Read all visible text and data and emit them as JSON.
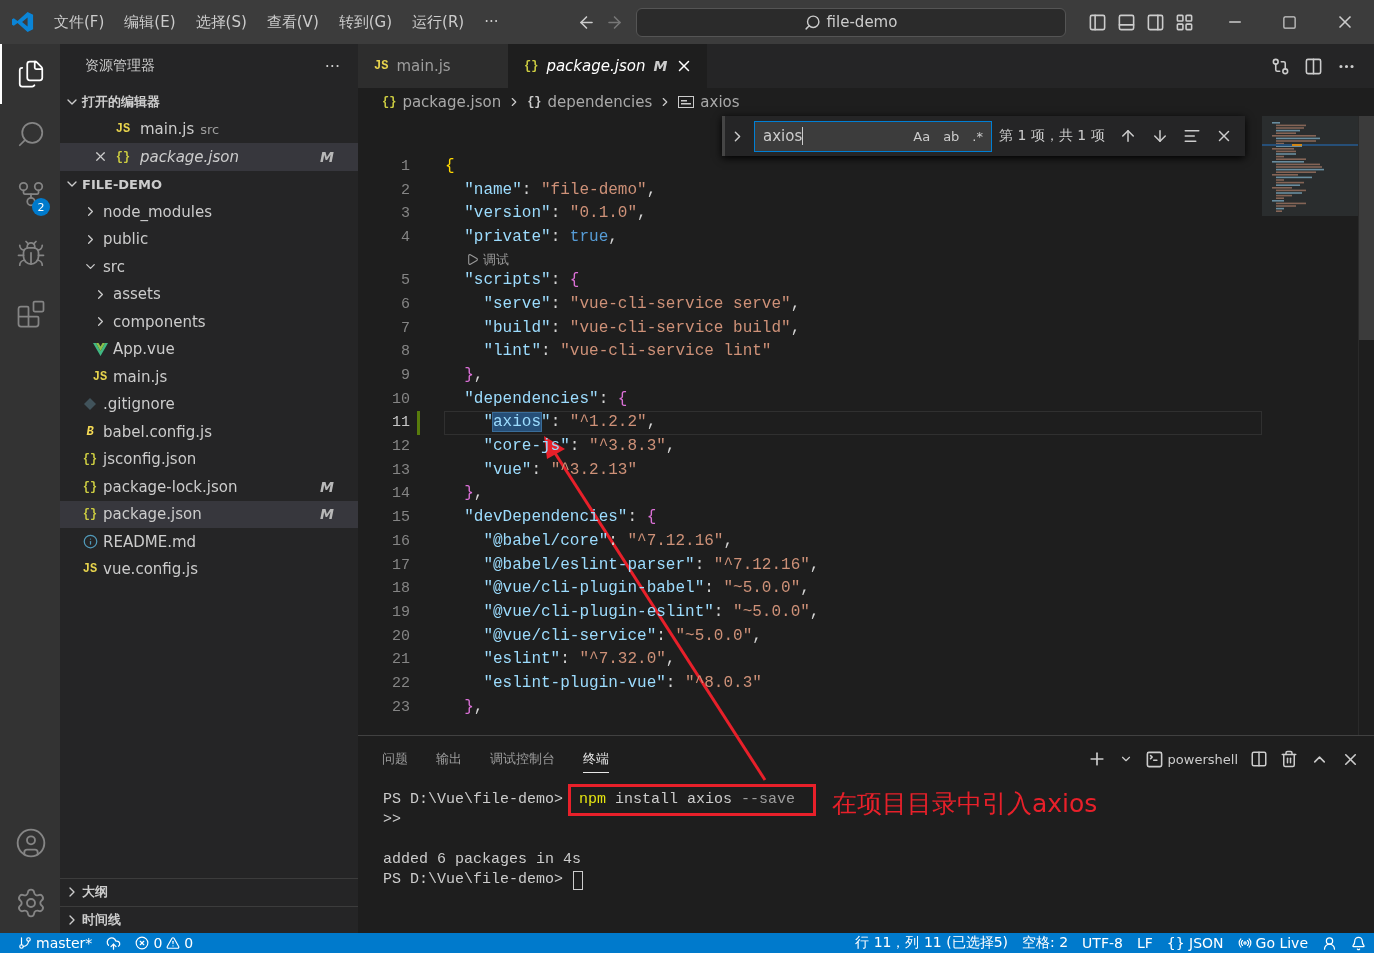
{
  "title_bar": {
    "menus": [
      "文件(F)",
      "编辑(E)",
      "选择(S)",
      "查看(V)",
      "转到(G)",
      "运行(R)"
    ],
    "more": "···",
    "search": "file-demo"
  },
  "activity_bar": {
    "items": [
      {
        "kind": "explorer",
        "selected": true
      },
      {
        "kind": "search",
        "selected": false
      },
      {
        "kind": "scm",
        "selected": false,
        "badge": "2"
      },
      {
        "kind": "debug",
        "selected": false
      },
      {
        "kind": "extensions",
        "selected": false
      }
    ],
    "bottom": [
      {
        "kind": "account"
      },
      {
        "kind": "settings"
      }
    ]
  },
  "sidebar": {
    "title": "资源管理器",
    "more": "···",
    "open_editors": {
      "title": "打开的编辑器",
      "expanded": true,
      "items": [
        {
          "icon": "JS",
          "kind": "js",
          "name": "main.js",
          "detail": "src",
          "selected": false,
          "italic": false,
          "closable": false
        },
        {
          "icon": "{}",
          "kind": "json",
          "name": "package.json",
          "status": "M",
          "selected": true,
          "italic": true,
          "closable": true
        }
      ]
    },
    "folder": {
      "title": "FILE-DEMO",
      "expanded": true,
      "items": [
        {
          "kind": "folder",
          "name": "node_modules",
          "expanded": false,
          "selected": false
        },
        {
          "kind": "folder",
          "name": "public",
          "expanded": false,
          "selected": false
        },
        {
          "kind": "folder",
          "name": "src",
          "expanded": true,
          "selected": false,
          "children": [
            {
              "kind": "folder",
              "name": "assets",
              "expanded": false,
              "selected": false
            },
            {
              "kind": "folder",
              "name": "components",
              "expanded": false,
              "selected": false
            },
            {
              "kind": "vue",
              "name": "App.vue",
              "selected": false
            },
            {
              "kind": "js",
              "icon": "JS",
              "name": "main.js",
              "selected": false
            }
          ]
        },
        {
          "kind": "git",
          "name": ".gitignore",
          "selected": false
        },
        {
          "kind": "babel",
          "icon": "B",
          "name": "babel.config.js",
          "selected": false
        },
        {
          "kind": "json",
          "icon": "{}",
          "name": "jsconfig.json",
          "selected": false
        },
        {
          "kind": "json",
          "icon": "{}",
          "name": "package-lock.json",
          "status": "M",
          "selected": false
        },
        {
          "kind": "json",
          "icon": "{}",
          "name": "package.json",
          "status": "M",
          "selected": true
        },
        {
          "kind": "info",
          "name": "README.md",
          "selected": false
        },
        {
          "kind": "js",
          "icon": "JS",
          "name": "vue.config.js",
          "selected": false
        }
      ]
    },
    "bottom_sections": [
      {
        "title": "大纲",
        "expanded": false
      },
      {
        "title": "时间线",
        "expanded": false
      }
    ]
  },
  "editor": {
    "tabs": [
      {
        "icon": "JS",
        "kind": "js",
        "label": "main.js",
        "selected": false,
        "italic": false,
        "closable": false
      },
      {
        "icon": "{}",
        "kind": "json",
        "label": "package.json",
        "status": "M",
        "selected": true,
        "italic": true,
        "closable": true
      }
    ],
    "breadcrumbs": [
      {
        "kind": "object",
        "icon": "{}",
        "label": "package.json"
      },
      {
        "kind": "object",
        "icon": "{}",
        "label": "dependencies"
      },
      {
        "kind": "string",
        "label": "axios"
      }
    ],
    "find": {
      "value": "axios",
      "options": [
        {
          "label": "Aa",
          "selected": false
        },
        {
          "label": "ab",
          "selected": false
        },
        {
          "label": ".*",
          "selected": false
        }
      ],
      "result": "第 1 项，共 1 项"
    },
    "lines": [
      {
        "kind": "code",
        "number": "1",
        "current": false,
        "changed": false,
        "tokens": [
          {
            "kind": "b1",
            "text": "{"
          }
        ]
      },
      {
        "kind": "code",
        "number": "2",
        "current": false,
        "changed": false,
        "tokens": [
          {
            "kind": "key",
            "text": "  \"name\""
          },
          {
            "kind": "p",
            "text": ": "
          },
          {
            "kind": "str",
            "text": "\"file-demo\""
          },
          {
            "kind": "p",
            "text": ","
          }
        ]
      },
      {
        "kind": "code",
        "number": "3",
        "current": false,
        "changed": false,
        "tokens": [
          {
            "kind": "key",
            "text": "  \"version\""
          },
          {
            "kind": "p",
            "text": ": "
          },
          {
            "kind": "str",
            "text": "\"0.1.0\""
          },
          {
            "kind": "p",
            "text": ","
          }
        ]
      },
      {
        "kind": "code",
        "number": "4",
        "current": false,
        "changed": false,
        "tokens": [
          {
            "kind": "key",
            "text": "  \"private\""
          },
          {
            "kind": "p",
            "text": ": "
          },
          {
            "kind": "lit",
            "text": "true"
          },
          {
            "kind": "p",
            "text": ","
          }
        ]
      },
      {
        "kind": "codelens",
        "label": "调试"
      },
      {
        "kind": "code",
        "number": "5",
        "current": false,
        "changed": false,
        "tokens": [
          {
            "kind": "key",
            "text": "  \"scripts\""
          },
          {
            "kind": "p",
            "text": ": "
          },
          {
            "kind": "b2",
            "text": "{"
          }
        ]
      },
      {
        "kind": "code",
        "number": "6",
        "current": false,
        "changed": false,
        "tokens": [
          {
            "kind": "key",
            "text": "    \"serve\""
          },
          {
            "kind": "p",
            "text": ": "
          },
          {
            "kind": "str",
            "text": "\"vue-cli-service serve\""
          },
          {
            "kind": "p",
            "text": ","
          }
        ]
      },
      {
        "kind": "code",
        "number": "7",
        "current": false,
        "changed": false,
        "tokens": [
          {
            "kind": "key",
            "text": "    \"build\""
          },
          {
            "kind": "p",
            "text": ": "
          },
          {
            "kind": "str",
            "text": "\"vue-cli-service build\""
          },
          {
            "kind": "p",
            "text": ","
          }
        ]
      },
      {
        "kind": "code",
        "number": "8",
        "current": false,
        "changed": false,
        "tokens": [
          {
            "kind": "key",
            "text": "    \"lint\""
          },
          {
            "kind": "p",
            "text": ": "
          },
          {
            "kind": "str",
            "text": "\"vue-cli-service lint\""
          }
        ]
      },
      {
        "kind": "code",
        "number": "9",
        "current": false,
        "changed": false,
        "tokens": [
          {
            "kind": "b2",
            "text": "  }"
          },
          {
            "kind": "p",
            "text": ","
          }
        ]
      },
      {
        "kind": "code",
        "number": "10",
        "current": false,
        "changed": false,
        "tokens": [
          {
            "kind": "key",
            "text": "  \"dependencies\""
          },
          {
            "kind": "p",
            "text": ": "
          },
          {
            "kind": "b2",
            "text": "{"
          }
        ]
      },
      {
        "kind": "code",
        "number": "11",
        "current": true,
        "changed": true,
        "tokens": [
          {
            "kind": "key",
            "text": "    \""
          },
          {
            "kind": "match",
            "text": "axios"
          },
          {
            "kind": "key",
            "text": "\""
          },
          {
            "kind": "p",
            "text": ": "
          },
          {
            "kind": "str",
            "text": "\"^1.2.2\""
          },
          {
            "kind": "p",
            "text": ","
          }
        ]
      },
      {
        "kind": "code",
        "number": "12",
        "current": false,
        "changed": false,
        "tokens": [
          {
            "kind": "key",
            "text": "    \"core-js\""
          },
          {
            "kind": "p",
            "text": ": "
          },
          {
            "kind": "str",
            "text": "\"^3.8.3\""
          },
          {
            "kind": "p",
            "text": ","
          }
        ]
      },
      {
        "kind": "code",
        "number": "13",
        "current": false,
        "changed": false,
        "tokens": [
          {
            "kind": "key",
            "text": "    \"vue\""
          },
          {
            "kind": "p",
            "text": ": "
          },
          {
            "kind": "str",
            "text": "\"^3.2.13\""
          }
        ]
      },
      {
        "kind": "code",
        "number": "14",
        "current": false,
        "changed": false,
        "tokens": [
          {
            "kind": "b2",
            "text": "  }"
          },
          {
            "kind": "p",
            "text": ","
          }
        ]
      },
      {
        "kind": "code",
        "number": "15",
        "current": false,
        "changed": false,
        "tokens": [
          {
            "kind": "key",
            "text": "  \"devDependencies\""
          },
          {
            "kind": "p",
            "text": ": "
          },
          {
            "kind": "b2",
            "text": "{"
          }
        ]
      },
      {
        "kind": "code",
        "number": "16",
        "current": false,
        "changed": false,
        "tokens": [
          {
            "kind": "key",
            "text": "    \"@babel/core\""
          },
          {
            "kind": "p",
            "text": ": "
          },
          {
            "kind": "str",
            "text": "\"^7.12.16\""
          },
          {
            "kind": "p",
            "text": ","
          }
        ]
      },
      {
        "kind": "code",
        "number": "17",
        "current": false,
        "changed": false,
        "tokens": [
          {
            "kind": "key",
            "text": "    \"@babel/eslint-parser\""
          },
          {
            "kind": "p",
            "text": ": "
          },
          {
            "kind": "str",
            "text": "\"^7.12.16\""
          },
          {
            "kind": "p",
            "text": ","
          }
        ]
      },
      {
        "kind": "code",
        "number": "18",
        "current": false,
        "changed": false,
        "tokens": [
          {
            "kind": "key",
            "text": "    \"@vue/cli-plugin-babel\""
          },
          {
            "kind": "p",
            "text": ": "
          },
          {
            "kind": "str",
            "text": "\"~5.0.0\""
          },
          {
            "kind": "p",
            "text": ","
          }
        ]
      },
      {
        "kind": "code",
        "number": "19",
        "current": false,
        "changed": false,
        "tokens": [
          {
            "kind": "key",
            "text": "    \"@vue/cli-plugin-eslint\""
          },
          {
            "kind": "p",
            "text": ": "
          },
          {
            "kind": "str",
            "text": "\"~5.0.0\""
          },
          {
            "kind": "p",
            "text": ","
          }
        ]
      },
      {
        "kind": "code",
        "number": "20",
        "current": false,
        "changed": false,
        "tokens": [
          {
            "kind": "key",
            "text": "    \"@vue/cli-service\""
          },
          {
            "kind": "p",
            "text": ": "
          },
          {
            "kind": "str",
            "text": "\"~5.0.0\""
          },
          {
            "kind": "p",
            "text": ","
          }
        ]
      },
      {
        "kind": "code",
        "number": "21",
        "current": false,
        "changed": false,
        "tokens": [
          {
            "kind": "key",
            "text": "    \"eslint\""
          },
          {
            "kind": "p",
            "text": ": "
          },
          {
            "kind": "str",
            "text": "\"^7.32.0\""
          },
          {
            "kind": "p",
            "text": ","
          }
        ]
      },
      {
        "kind": "code",
        "number": "22",
        "current": false,
        "changed": false,
        "tokens": [
          {
            "kind": "key",
            "text": "    \"eslint-plugin-vue\""
          },
          {
            "kind": "p",
            "text": ": "
          },
          {
            "kind": "str",
            "text": "\"^8.0.3\""
          }
        ]
      },
      {
        "kind": "code",
        "number": "23",
        "current": false,
        "changed": false,
        "tokens": [
          {
            "kind": "b2",
            "text": "  }"
          },
          {
            "kind": "p",
            "text": ","
          }
        ]
      }
    ]
  },
  "panel": {
    "tabs": [
      {
        "label": "问题",
        "selected": false
      },
      {
        "label": "输出",
        "selected": false
      },
      {
        "label": "调试控制台",
        "selected": false
      },
      {
        "label": "终端",
        "selected": true
      }
    ],
    "profile": "powershell",
    "blocks": [
      [
        {
          "segments": [
            {
              "kind": "prompt",
              "text": "PS D:\\Vue\\file-demo> "
            },
            {
              "kind": "cmd",
              "text": "npm"
            },
            {
              "kind": "arg",
              "text": " install axios "
            },
            {
              "kind": "flag",
              "text": "--save"
            }
          ],
          "cursor": false,
          "annotated": true
        },
        {
          "segments": [
            {
              "kind": "prompt",
              "text": ">>"
            }
          ],
          "cursor": false,
          "annotated": false
        }
      ],
      [
        {
          "segments": [
            {
              "kind": "arg",
              "text": "added 6 packages in 4s"
            }
          ],
          "cursor": false,
          "annotated": false
        },
        {
          "segments": [
            {
              "kind": "prompt",
              "text": "PS D:\\Vue\\file-demo> "
            }
          ],
          "cursor": true,
          "annotated": false
        }
      ]
    ]
  },
  "annotation": {
    "note": "在项目目录中引入axios"
  },
  "status_bar": {
    "branch": "master*",
    "errors": "0",
    "warnings": "0",
    "right": [
      {
        "kind": "text",
        "label": "行 11，列 11 (已选择5)"
      },
      {
        "kind": "text",
        "label": "空格: 2"
      },
      {
        "kind": "text",
        "label": "UTF-8"
      },
      {
        "kind": "text",
        "label": "LF"
      },
      {
        "kind": "language",
        "icon": "{}",
        "label": "JSON"
      },
      {
        "kind": "live",
        "label": "Go Live"
      },
      {
        "kind": "account"
      },
      {
        "kind": "bell"
      }
    ]
  }
}
